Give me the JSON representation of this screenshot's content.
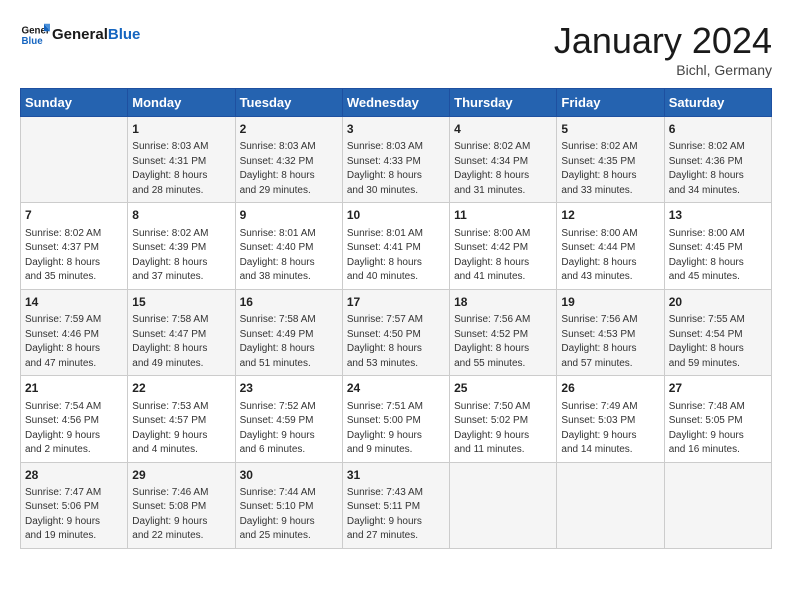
{
  "header": {
    "logo_general": "General",
    "logo_blue": "Blue",
    "month_title": "January 2024",
    "location": "Bichl, Germany"
  },
  "weekdays": [
    "Sunday",
    "Monday",
    "Tuesday",
    "Wednesday",
    "Thursday",
    "Friday",
    "Saturday"
  ],
  "weeks": [
    [
      {
        "day": "",
        "info": ""
      },
      {
        "day": "1",
        "info": "Sunrise: 8:03 AM\nSunset: 4:31 PM\nDaylight: 8 hours\nand 28 minutes."
      },
      {
        "day": "2",
        "info": "Sunrise: 8:03 AM\nSunset: 4:32 PM\nDaylight: 8 hours\nand 29 minutes."
      },
      {
        "day": "3",
        "info": "Sunrise: 8:03 AM\nSunset: 4:33 PM\nDaylight: 8 hours\nand 30 minutes."
      },
      {
        "day": "4",
        "info": "Sunrise: 8:02 AM\nSunset: 4:34 PM\nDaylight: 8 hours\nand 31 minutes."
      },
      {
        "day": "5",
        "info": "Sunrise: 8:02 AM\nSunset: 4:35 PM\nDaylight: 8 hours\nand 33 minutes."
      },
      {
        "day": "6",
        "info": "Sunrise: 8:02 AM\nSunset: 4:36 PM\nDaylight: 8 hours\nand 34 minutes."
      }
    ],
    [
      {
        "day": "7",
        "info": "Sunrise: 8:02 AM\nSunset: 4:37 PM\nDaylight: 8 hours\nand 35 minutes."
      },
      {
        "day": "8",
        "info": "Sunrise: 8:02 AM\nSunset: 4:39 PM\nDaylight: 8 hours\nand 37 minutes."
      },
      {
        "day": "9",
        "info": "Sunrise: 8:01 AM\nSunset: 4:40 PM\nDaylight: 8 hours\nand 38 minutes."
      },
      {
        "day": "10",
        "info": "Sunrise: 8:01 AM\nSunset: 4:41 PM\nDaylight: 8 hours\nand 40 minutes."
      },
      {
        "day": "11",
        "info": "Sunrise: 8:00 AM\nSunset: 4:42 PM\nDaylight: 8 hours\nand 41 minutes."
      },
      {
        "day": "12",
        "info": "Sunrise: 8:00 AM\nSunset: 4:44 PM\nDaylight: 8 hours\nand 43 minutes."
      },
      {
        "day": "13",
        "info": "Sunrise: 8:00 AM\nSunset: 4:45 PM\nDaylight: 8 hours\nand 45 minutes."
      }
    ],
    [
      {
        "day": "14",
        "info": "Sunrise: 7:59 AM\nSunset: 4:46 PM\nDaylight: 8 hours\nand 47 minutes."
      },
      {
        "day": "15",
        "info": "Sunrise: 7:58 AM\nSunset: 4:47 PM\nDaylight: 8 hours\nand 49 minutes."
      },
      {
        "day": "16",
        "info": "Sunrise: 7:58 AM\nSunset: 4:49 PM\nDaylight: 8 hours\nand 51 minutes."
      },
      {
        "day": "17",
        "info": "Sunrise: 7:57 AM\nSunset: 4:50 PM\nDaylight: 8 hours\nand 53 minutes."
      },
      {
        "day": "18",
        "info": "Sunrise: 7:56 AM\nSunset: 4:52 PM\nDaylight: 8 hours\nand 55 minutes."
      },
      {
        "day": "19",
        "info": "Sunrise: 7:56 AM\nSunset: 4:53 PM\nDaylight: 8 hours\nand 57 minutes."
      },
      {
        "day": "20",
        "info": "Sunrise: 7:55 AM\nSunset: 4:54 PM\nDaylight: 8 hours\nand 59 minutes."
      }
    ],
    [
      {
        "day": "21",
        "info": "Sunrise: 7:54 AM\nSunset: 4:56 PM\nDaylight: 9 hours\nand 2 minutes."
      },
      {
        "day": "22",
        "info": "Sunrise: 7:53 AM\nSunset: 4:57 PM\nDaylight: 9 hours\nand 4 minutes."
      },
      {
        "day": "23",
        "info": "Sunrise: 7:52 AM\nSunset: 4:59 PM\nDaylight: 9 hours\nand 6 minutes."
      },
      {
        "day": "24",
        "info": "Sunrise: 7:51 AM\nSunset: 5:00 PM\nDaylight: 9 hours\nand 9 minutes."
      },
      {
        "day": "25",
        "info": "Sunrise: 7:50 AM\nSunset: 5:02 PM\nDaylight: 9 hours\nand 11 minutes."
      },
      {
        "day": "26",
        "info": "Sunrise: 7:49 AM\nSunset: 5:03 PM\nDaylight: 9 hours\nand 14 minutes."
      },
      {
        "day": "27",
        "info": "Sunrise: 7:48 AM\nSunset: 5:05 PM\nDaylight: 9 hours\nand 16 minutes."
      }
    ],
    [
      {
        "day": "28",
        "info": "Sunrise: 7:47 AM\nSunset: 5:06 PM\nDaylight: 9 hours\nand 19 minutes."
      },
      {
        "day": "29",
        "info": "Sunrise: 7:46 AM\nSunset: 5:08 PM\nDaylight: 9 hours\nand 22 minutes."
      },
      {
        "day": "30",
        "info": "Sunrise: 7:44 AM\nSunset: 5:10 PM\nDaylight: 9 hours\nand 25 minutes."
      },
      {
        "day": "31",
        "info": "Sunrise: 7:43 AM\nSunset: 5:11 PM\nDaylight: 9 hours\nand 27 minutes."
      },
      {
        "day": "",
        "info": ""
      },
      {
        "day": "",
        "info": ""
      },
      {
        "day": "",
        "info": ""
      }
    ]
  ]
}
